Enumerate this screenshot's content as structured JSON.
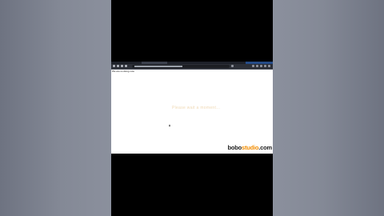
{
  "video": {
    "page_text": "We are re-doing now",
    "loading_text": "Please wait a moment...",
    "watermark": {
      "part1": "bobo",
      "part2": "studio",
      "part3": ".com"
    }
  },
  "colors": {
    "watermark_accent": "#f28c00",
    "browser_chrome": "#2c2f37",
    "page_bg": "#ffffff"
  },
  "icons": [
    "back-arrow-icon",
    "forward-arrow-icon",
    "reload-icon",
    "home-icon",
    "extension-icon",
    "mouse-cursor-icon"
  ]
}
